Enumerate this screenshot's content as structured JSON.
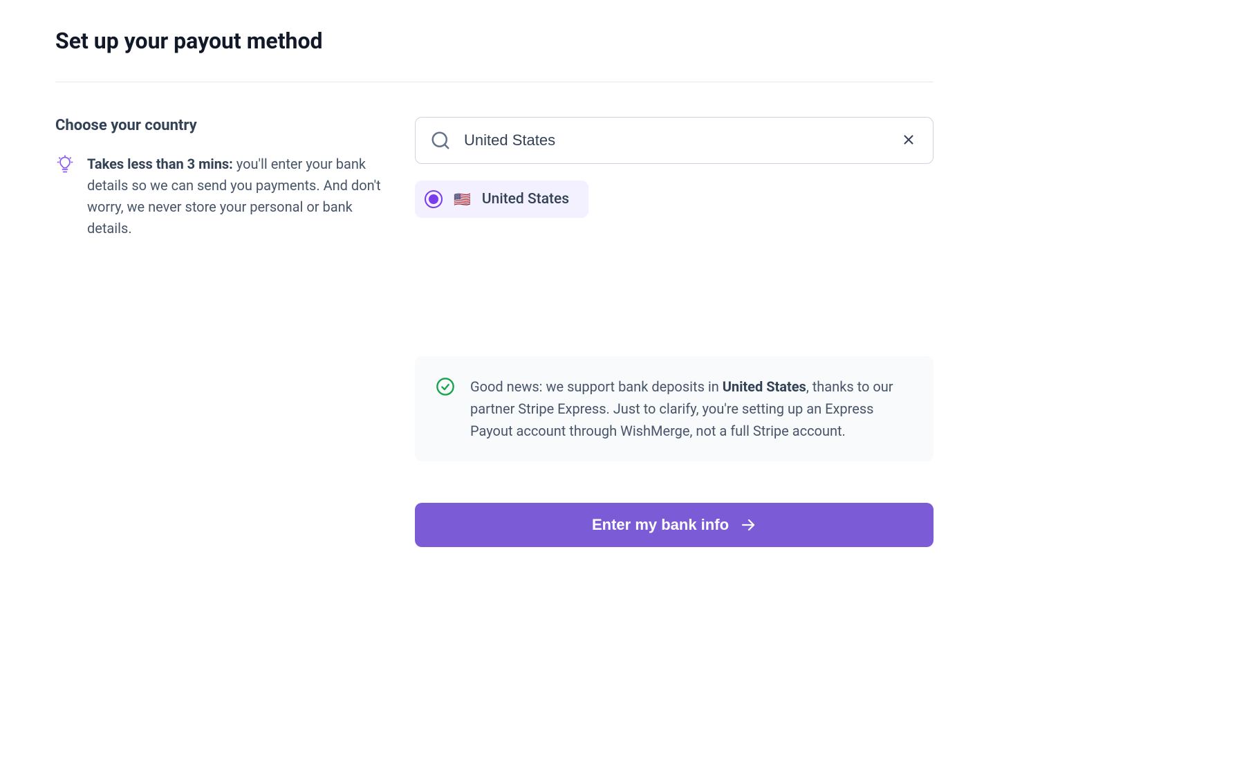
{
  "page": {
    "title": "Set up your payout method"
  },
  "left": {
    "heading": "Choose your country",
    "tip_bold": "Takes less than 3 mins:",
    "tip_rest": " you'll enter your bank details so we can send you payments. And don't worry, we never store your personal or bank details."
  },
  "search": {
    "value": "United States"
  },
  "selected_country": {
    "flag": "🇺🇸",
    "label": "United States"
  },
  "info": {
    "prefix": "Good news: we support bank deposits in ",
    "country": "United States",
    "suffix": ", thanks to our partner Stripe Express. Just to clarify, you're setting up an Express Payout account through WishMerge, not a full Stripe account."
  },
  "cta": {
    "label": "Enter my bank info"
  }
}
